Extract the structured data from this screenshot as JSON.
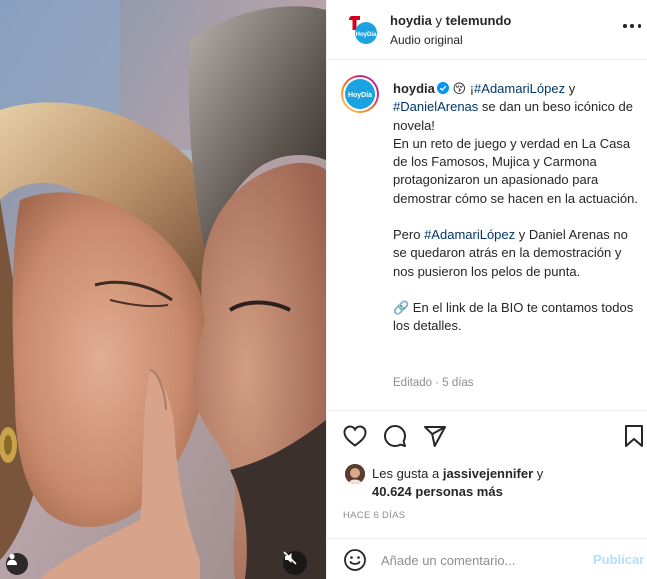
{
  "media": {
    "description_icons": [
      "user-tag-icon",
      "audio-muted-icon"
    ]
  },
  "header": {
    "account": "hoydia",
    "separator": " y ",
    "collaborator": "telemundo",
    "audio_label": "Audio original",
    "logo_text": "HoyDía"
  },
  "caption": {
    "username": "hoydia",
    "emoji": "😚",
    "open_mark": " ¡",
    "tag1": "#AdamariLópez",
    "conn1": " y ",
    "tag2": "#DanielArenas",
    "line1_rest": " se dan un beso icónico de novela!",
    "para1": "En un reto de juego y verdad en La Casa de los Famosos, Mujica y Carmona protagonizaron un apasionado para demostrar cómo se hacen en la actuación.",
    "para2_pre": "Pero ",
    "para2_tag": "#AdamariLópez",
    "para2_rest": " y Daniel Arenas no se quedaron atrás en la demostración y nos pusieron los pelos de punta.",
    "para3": "🔗 En el link de la BIO te contamos todos los detalles.",
    "edited": "Editado · 5 días"
  },
  "actions": {
    "icons": [
      "heart-icon",
      "comment-icon",
      "share-icon",
      "bookmark-icon"
    ]
  },
  "likes": {
    "prefix": "Les gusta a ",
    "user": "jassivejennifer",
    "conn": " y",
    "count": "40.624 personas más"
  },
  "time_ago": "HACE 6 DÍAS",
  "comment": {
    "placeholder": "Añade un comentario...",
    "publish": "Publicar"
  },
  "colors": {
    "accent": "#0095f6",
    "publish_disabled": "#b2dffc",
    "hashtag": "#00376b",
    "muted": "#8e8e8e",
    "brand_blue": "#1aa3e0",
    "brand_red": "#d6001c"
  }
}
